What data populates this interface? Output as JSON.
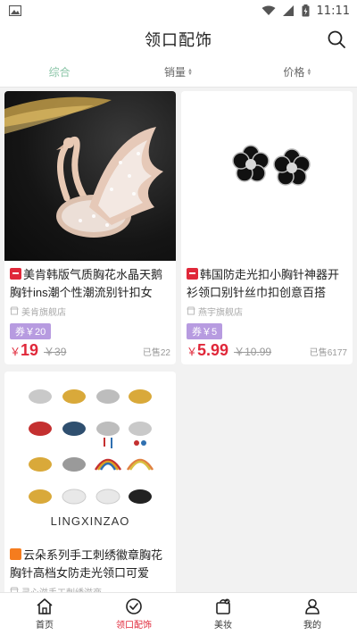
{
  "status": {
    "time": "11:11"
  },
  "header": {
    "title": "领口配饰"
  },
  "sort": {
    "tabs": [
      {
        "label": "综合"
      },
      {
        "label": "销量"
      },
      {
        "label": "价格"
      }
    ]
  },
  "products": [
    {
      "name": "美肯韩版气质胸花水晶天鹅胸针ins潮个性潮流别针扣女士…",
      "shop": "美肯旗舰店",
      "coupon": "券￥20",
      "price": "19",
      "original_price": "￥39",
      "sold": "已售22"
    },
    {
      "name": "韩国防走光扣小胸针神器开衫领口别针丝巾扣创意百搭装…",
      "shop": "燕宇旗舰店",
      "coupon": "券￥5",
      "price": "5.99",
      "original_price": "￥10.99",
      "sold": "已售6177"
    },
    {
      "name": "云朵系列手工刺绣徽章胸花胸针高档女防走光领口可爱日…",
      "shop": "灵心滋手工刺绣滋商",
      "brand_text": "LINGXINZAO"
    }
  ],
  "currency": "￥",
  "tabbar": {
    "items": [
      {
        "label": "首页"
      },
      {
        "label": "领口配饰"
      },
      {
        "label": "美妆"
      },
      {
        "label": "我的"
      }
    ]
  },
  "colors": {
    "accent_red": "#e0283a",
    "sort_active": "#8ac5a7",
    "coupon": "#b79be0"
  }
}
